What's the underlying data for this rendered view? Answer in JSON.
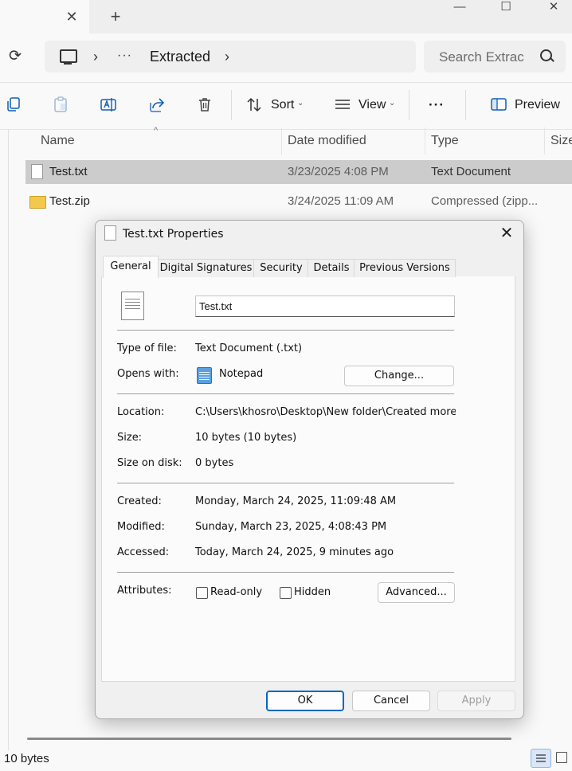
{
  "window": {
    "minimize_glyph": "—",
    "maximize_glyph": "☐",
    "close_glyph": "✕",
    "tab_close_glyph": "✕",
    "new_tab_glyph": "+"
  },
  "address": {
    "refresh_glyph": "⟳",
    "chevron": "›",
    "overflow": "···",
    "current_folder": "Extracted",
    "trailing_chevron": "›"
  },
  "search": {
    "placeholder": "Search Extrac"
  },
  "commands": {
    "sort_label": "Sort",
    "view_label": "View",
    "more_glyph": "···",
    "preview_label": "Preview",
    "dropdown_glyph": "⌄"
  },
  "columns": {
    "name": "Name",
    "date_modified": "Date modified",
    "type": "Type",
    "size": "Size",
    "sort_glyph": "^"
  },
  "files": [
    {
      "name": "Test.txt",
      "date": "3/23/2025 4:08 PM",
      "type": "Text Document",
      "selected": true
    },
    {
      "name": "Test.zip",
      "date": "3/24/2025 11:09 AM",
      "type": "Compressed (zipp...",
      "selected": false
    }
  ],
  "status": {
    "selection": "10 bytes"
  },
  "dialog": {
    "title": "Test.txt Properties",
    "close_glyph": "✕",
    "tabs": [
      "General",
      "Digital Signatures",
      "Security",
      "Details",
      "Previous Versions"
    ],
    "active_tab": "General",
    "file_name": "Test.txt",
    "type_of_file_label": "Type of file:",
    "type_of_file": "Text Document (.txt)",
    "opens_with_label": "Opens with:",
    "opens_with": "Notepad",
    "change_button": "Change...",
    "location_label": "Location:",
    "location": "C:\\Users\\khosro\\Desktop\\New folder\\Created more tha",
    "size_label": "Size:",
    "size": "10 bytes (10 bytes)",
    "size_on_disk_label": "Size on disk:",
    "size_on_disk": "0 bytes",
    "created_label": "Created:",
    "created": "Monday, March 24, 2025, 11:09:48 AM",
    "modified_label": "Modified:",
    "modified": "Sunday, March 23, 2025, 4:08:43 PM",
    "accessed_label": "Accessed:",
    "accessed": "Today, March 24, 2025, 9 minutes ago",
    "attributes_label": "Attributes:",
    "readonly_label": "Read-only",
    "readonly_checked": false,
    "hidden_label": "Hidden",
    "hidden_checked": false,
    "advanced_button": "Advanced...",
    "ok_button": "OK",
    "cancel_button": "Cancel",
    "apply_button": "Apply"
  }
}
